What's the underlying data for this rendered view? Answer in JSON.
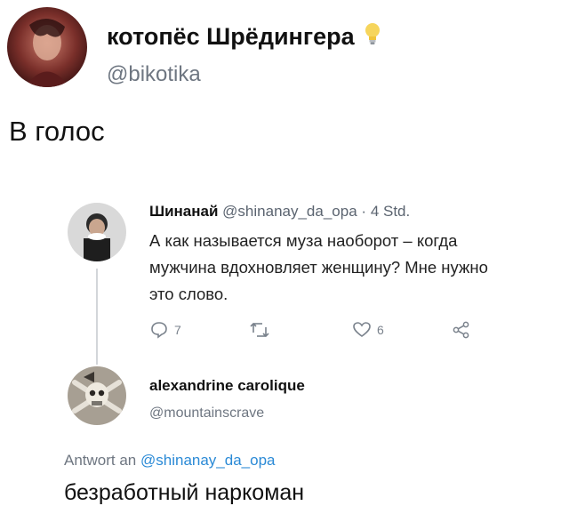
{
  "outer_tweet": {
    "display_name": "котопёс Шрёдингера",
    "handle": "@bikotika",
    "text": "В голос",
    "name_emoji_icon": "light-bulb-icon"
  },
  "quoted_tweet": {
    "author_name": "Шинанай",
    "author_handle": "@shinanay_da_opa",
    "separator": "·",
    "age": "4 Std.",
    "text": "А как называется муза наоборот – когда мужчина вдохновляет женщину? Мне нужно это слово.",
    "actions": {
      "reply_count": "7",
      "retweet_count": "",
      "like_count": "6"
    }
  },
  "reply": {
    "author_name": "alexandrine carolique",
    "author_handle": "@mountainscrave",
    "replying_to_prefix": "Antwort an",
    "replying_to_handle": "@shinanay_da_opa",
    "text": "безработный наркоман"
  },
  "colors": {
    "link": "#2b8ad6",
    "muted": "#6e7681",
    "text": "#111111"
  }
}
